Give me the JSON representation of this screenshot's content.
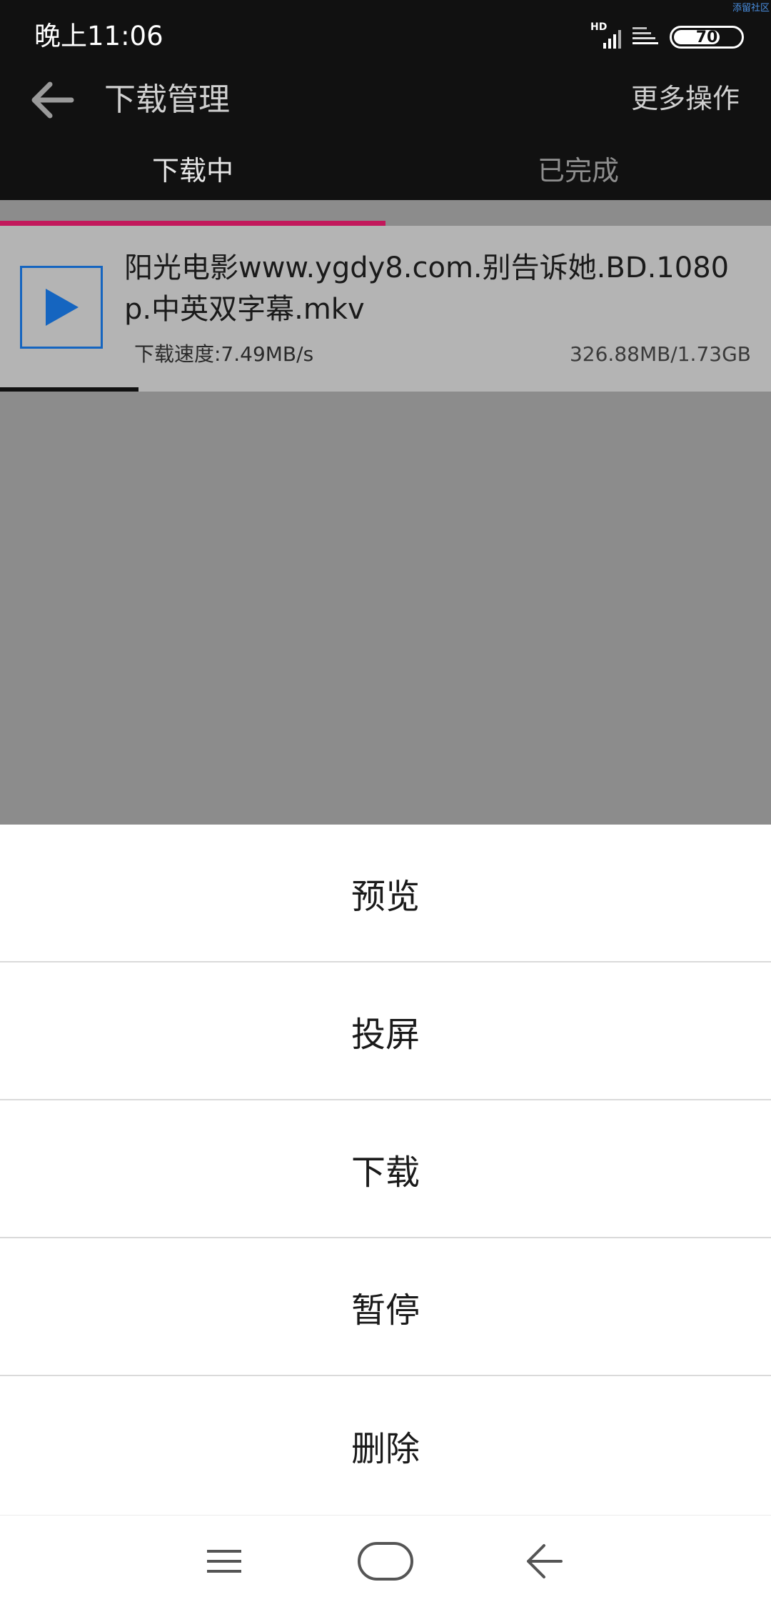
{
  "status_bar": {
    "time": "晚上11:06",
    "network_label": "HD",
    "battery_level": "70",
    "watermark": "添留社区"
  },
  "app_bar": {
    "title": "下载管理",
    "more_label": "更多操作"
  },
  "tabs": [
    {
      "label": "下载中",
      "active": true
    },
    {
      "label": "已完成",
      "active": false
    }
  ],
  "download_item": {
    "file_name": "阳光电影www.ygdy8.com.别告诉她.BD.1080p.中英双字幕.mkv",
    "speed": "下载速度:7.49MB/s",
    "size": "326.88MB/1.73GB",
    "progress_fraction": 0.18
  },
  "action_sheet": {
    "items": [
      {
        "label": "预览"
      },
      {
        "label": "投屏"
      },
      {
        "label": "下载"
      },
      {
        "label": "暂停"
      },
      {
        "label": "删除"
      }
    ]
  },
  "colors": {
    "accent": "#c2185b",
    "play_blue": "#1565c0",
    "dark_bar": "#111111"
  },
  "icons": {
    "back": "arrow-left-icon",
    "play": "play-icon",
    "menu": "menu-icon",
    "home": "home-icon",
    "nav_back": "chevron-left-icon"
  }
}
